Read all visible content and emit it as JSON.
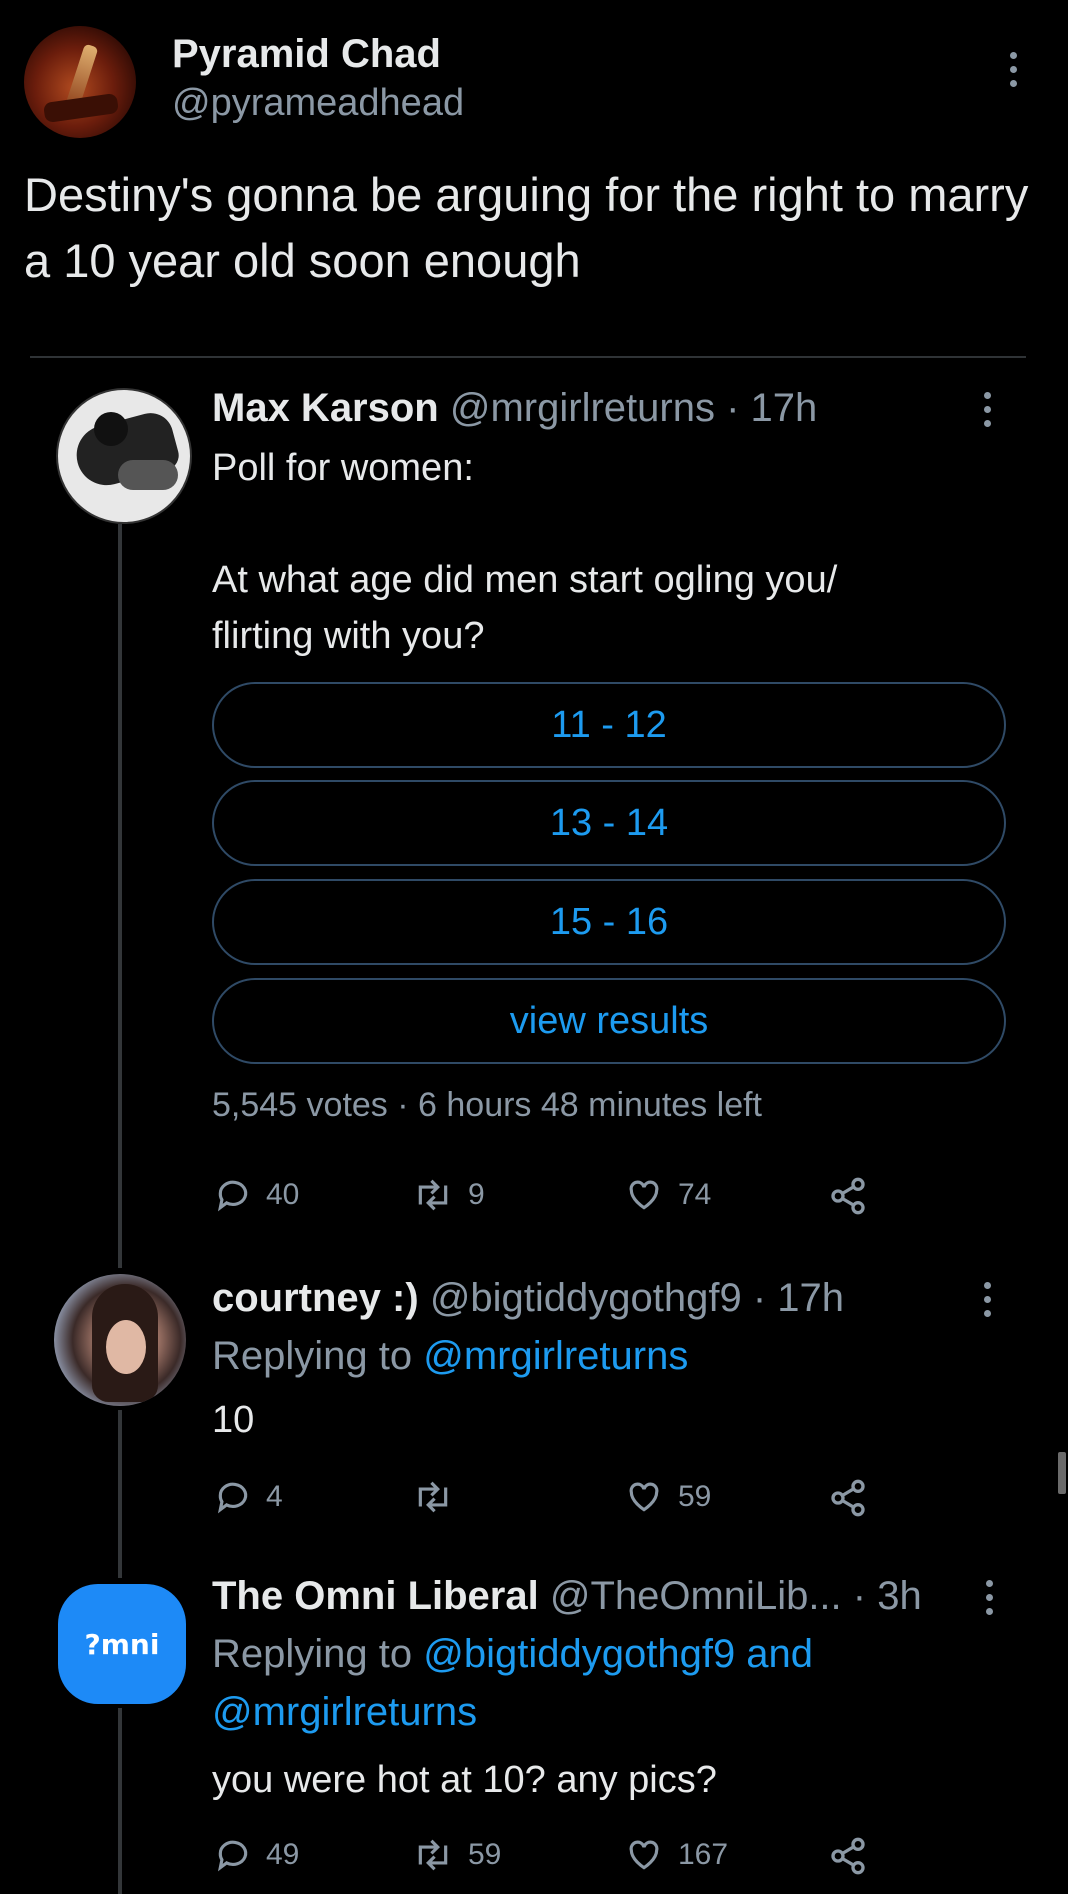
{
  "main_tweet": {
    "display_name": "Pyramid Chad",
    "handle": "@pyrameadhead",
    "text": "Destiny's gonna be arguing for the right to marry a 10 year old soon enough"
  },
  "quoted_thread": [
    {
      "display_name": "Max Karson",
      "handle": "@mrgirlreturns",
      "time": "· 17h",
      "text_line1": "Poll for women:",
      "text_line2": "At what age did men start ogling you/",
      "text_line3": "flirting with you?",
      "poll": {
        "options": [
          "11 - 12",
          "13 - 14",
          "15 - 16"
        ],
        "view_results": "view results",
        "votes": "5,545 votes",
        "separator": "·",
        "time_left": "6 hours 48 minutes left"
      },
      "actions": {
        "replies": "40",
        "retweets": "9",
        "likes": "74"
      }
    },
    {
      "display_name": "courtney :)",
      "handle": "@bigtiddygothgf9",
      "time": "· 17h",
      "replying_prefix": "Replying to",
      "replying_to": "@mrgirlreturns",
      "text": "10",
      "actions": {
        "replies": "4",
        "retweets": "",
        "likes": "59"
      }
    },
    {
      "display_name": "The Omni Liberal",
      "handle": "@TheOmniLib...",
      "time": "· 3h",
      "avatar_text": "?mni",
      "replying_prefix": "Replying to",
      "replying_to_1": "@bigtiddygothgf9 and",
      "replying_to_2": "@mrgirlreturns",
      "text": "you were hot at 10? any pics?",
      "actions": {
        "replies": "49",
        "retweets": "59",
        "likes": "167"
      }
    }
  ],
  "colors": {
    "background": "#000000",
    "text": "#e7e9ea",
    "muted": "#8b98a5",
    "link": "#1d9bf0",
    "omni_avatar": "#1d8af7"
  },
  "icons": [
    "more-icon",
    "reply-icon",
    "retweet-icon",
    "like-icon",
    "share-icon"
  ]
}
